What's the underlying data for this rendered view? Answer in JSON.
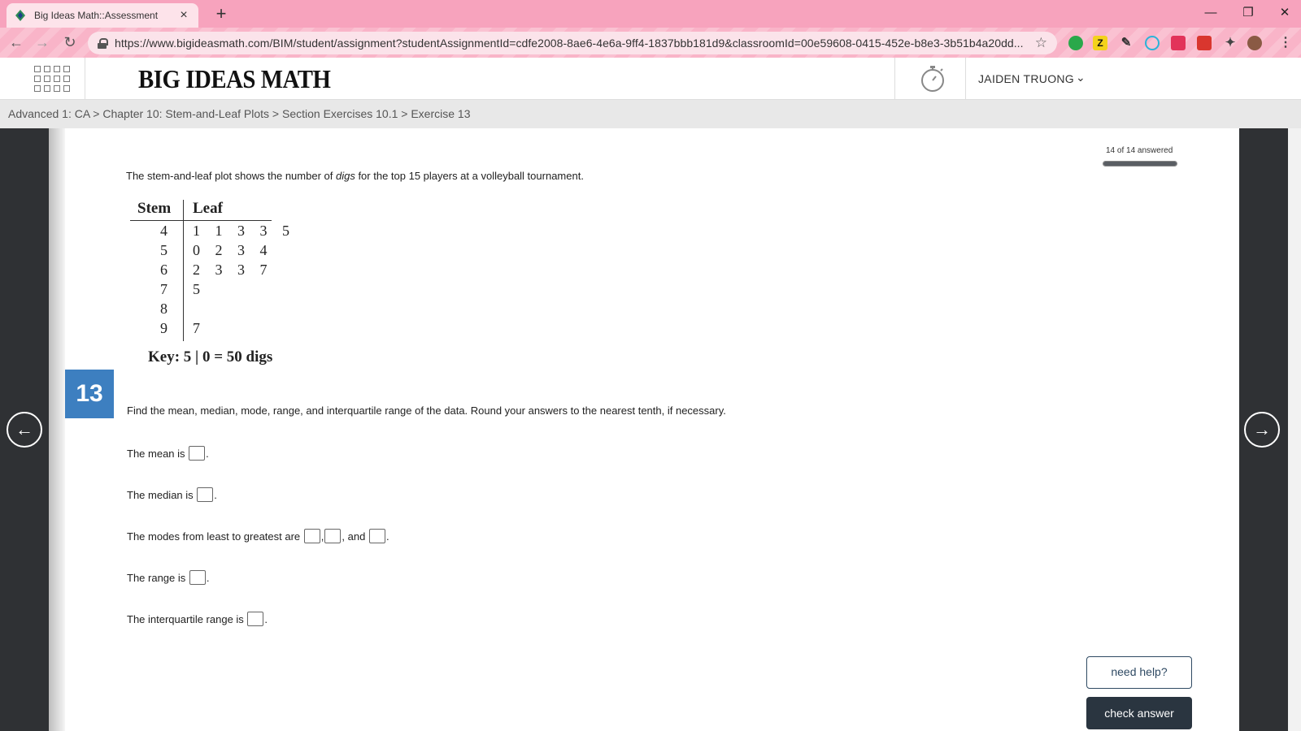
{
  "browser": {
    "tab_title": "Big Ideas Math::Assessment",
    "url": "https://www.bigideasmath.com/BIM/student/assignment?studentAssignmentId=cdfe2008-8ae6-4e6a-9ff4-1837bbb181d9&classroomId=00e59608-0415-452e-b8e3-3b51b4a20dd..."
  },
  "header": {
    "logo": "BIG IDEAS MATH",
    "user_name": "JAIDEN TRUONG"
  },
  "breadcrumb": "Advanced 1: CA > Chapter 10: Stem-and-Leaf Plots > Section Exercises 10.1 > Exercise 13",
  "progress": {
    "label": "14 of 14 answered",
    "fraction": 1.0
  },
  "question": {
    "number": "13",
    "intro_before": "The stem-and-leaf plot shows the number of ",
    "intro_italic": "digs",
    "intro_after": " for the top 15 players at a volleyball tournament.",
    "plot": {
      "stem_header": "Stem",
      "leaf_header": "Leaf",
      "rows": [
        {
          "stem": "4",
          "leaves": "1 1 3 3 5"
        },
        {
          "stem": "5",
          "leaves": "0 2 3 4"
        },
        {
          "stem": "6",
          "leaves": "2 3 3 7"
        },
        {
          "stem": "7",
          "leaves": "5"
        },
        {
          "stem": "8",
          "leaves": ""
        },
        {
          "stem": "9",
          "leaves": "7"
        }
      ],
      "key": "Key:  5 | 0 = 50 digs"
    },
    "prompt": "Find the mean, median, mode, range, and interquartile range of the data. Round your answers to the nearest tenth, if necessary.",
    "answers": {
      "mean": "The mean is ",
      "median": "The median is ",
      "modes": "The modes from least to greatest are ",
      "modes_and": " and ",
      "range": "The range is ",
      "iqr": "The interquartile range is ",
      "comma": ",",
      "period": "."
    }
  },
  "buttons": {
    "need_help": "need help?",
    "check_answer": "check answer"
  },
  "icons": {
    "prev": "←",
    "next": "→",
    "chevron": "⌄"
  },
  "colors": {
    "chrome_pink": "#f7a3bd",
    "question_badge": "#3d7fc0",
    "dark_button": "#2a3540"
  }
}
